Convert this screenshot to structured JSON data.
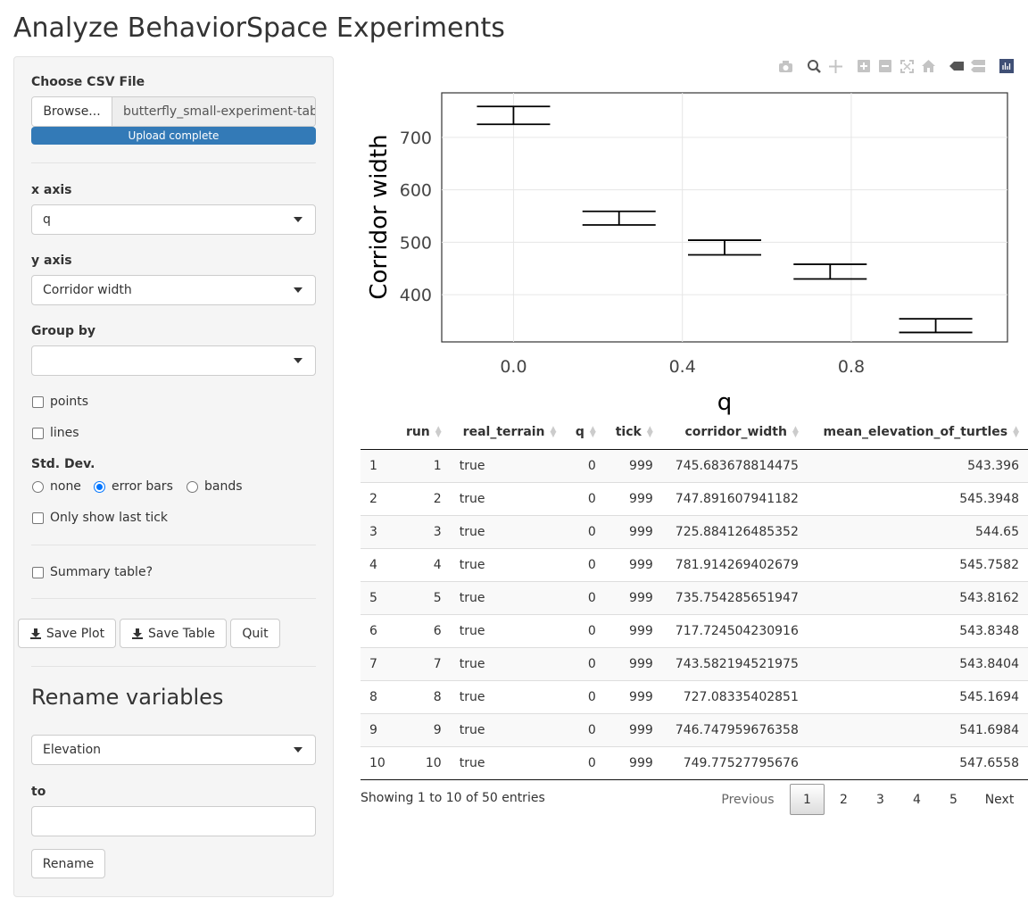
{
  "page": {
    "title": "Analyze BehaviorSpace Experiments"
  },
  "sidebar": {
    "csv_label": "Choose CSV File",
    "browse_label": "Browse...",
    "file_name": "butterfly_small-experiment-table.csv",
    "progress_text": "Upload complete",
    "progress_value": 1.0,
    "x_axis_label": "x axis",
    "x_axis_value": "q",
    "y_axis_label": "y axis",
    "y_axis_value": "Corridor width",
    "group_by_label": "Group by",
    "group_by_value": "",
    "points_label": "points",
    "points_checked": false,
    "lines_label": "lines",
    "lines_checked": false,
    "stddev_label": "Std. Dev.",
    "stddev_options": [
      "none",
      "error bars",
      "bands"
    ],
    "stddev_selected": "error bars",
    "last_tick_label": "Only show last tick",
    "last_tick_checked": false,
    "summary_label": "Summary table?",
    "summary_checked": false,
    "save_plot_label": "Save Plot",
    "save_table_label": "Save Table",
    "quit_label": "Quit",
    "rename_heading": "Rename variables",
    "rename_select_value": "Elevation",
    "to_label": "to",
    "rename_input_value": "",
    "rename_button_label": "Rename"
  },
  "modebar": {
    "icons": [
      "camera-icon",
      "zoom-icon",
      "pan-icon",
      "zoom-in-icon",
      "zoom-out-icon",
      "autoscale-icon",
      "reset-axes-icon",
      "spike-lines-icon",
      "compare-hover-icon",
      "plotly-logo-icon"
    ]
  },
  "chart_data": {
    "type": "errorbar",
    "xlabel": "q",
    "ylabel": "Corridor width",
    "xticks": [
      "0.0",
      "0.4",
      "0.8"
    ],
    "yticks": [
      "400",
      "500",
      "600",
      "700"
    ],
    "xlim": [
      -0.17,
      1.17
    ],
    "ylim": [
      310,
      785
    ],
    "grid": true,
    "series": [
      {
        "x": [
          0,
          0.25,
          0.5,
          0.75,
          1.0
        ],
        "y": [
          742,
          546,
          490,
          444,
          341
        ],
        "err": [
          17,
          13,
          14,
          14,
          13
        ],
        "color": "#000000"
      }
    ]
  },
  "table": {
    "columns": [
      "",
      "run",
      "real_terrain",
      "q",
      "tick",
      "corridor_width",
      "mean_elevation_of_turtles"
    ],
    "rows": [
      [
        "1",
        "1",
        "true",
        "0",
        "999",
        "745.683678814475",
        "543.396"
      ],
      [
        "2",
        "2",
        "true",
        "0",
        "999",
        "747.891607941182",
        "545.3948"
      ],
      [
        "3",
        "3",
        "true",
        "0",
        "999",
        "725.884126485352",
        "544.65"
      ],
      [
        "4",
        "4",
        "true",
        "0",
        "999",
        "781.914269402679",
        "545.7582"
      ],
      [
        "5",
        "5",
        "true",
        "0",
        "999",
        "735.754285651947",
        "543.8162"
      ],
      [
        "6",
        "6",
        "true",
        "0",
        "999",
        "717.724504230916",
        "543.8348"
      ],
      [
        "7",
        "7",
        "true",
        "0",
        "999",
        "743.582194521975",
        "543.8404"
      ],
      [
        "8",
        "8",
        "true",
        "0",
        "999",
        "727.08335402851",
        "545.1694"
      ],
      [
        "9",
        "9",
        "true",
        "0",
        "999",
        "746.747959676358",
        "541.6984"
      ],
      [
        "10",
        "10",
        "true",
        "0",
        "999",
        "749.77527795676",
        "547.6558"
      ]
    ],
    "info": "Showing 1 to 10 of 50 entries",
    "pager": {
      "previous": "Previous",
      "pages": [
        "1",
        "2",
        "3",
        "4",
        "5"
      ],
      "current": "1",
      "next": "Next"
    }
  }
}
